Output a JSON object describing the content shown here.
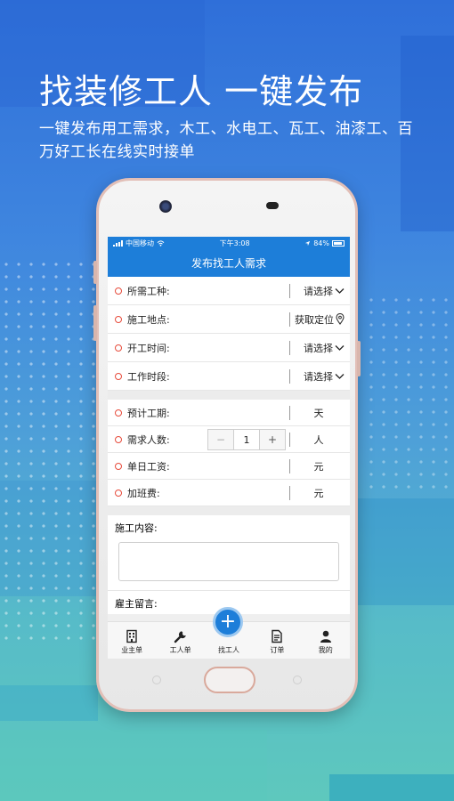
{
  "promo": {
    "headline": "找装修工人 一键发布",
    "subline": "一键发布用工需求，木工、水电工、瓦工、油漆工、百万好工长在线实时接单"
  },
  "status_bar": {
    "carrier": "中国移动",
    "time": "下午3:08",
    "battery": "84%"
  },
  "screen_title": "发布找工人需求",
  "form": {
    "worker_type": {
      "label": "所需工种:",
      "value": "请选择"
    },
    "location": {
      "label": "施工地点:",
      "value": "获取定位"
    },
    "start_time": {
      "label": "开工时间:",
      "value": "请选择"
    },
    "work_period": {
      "label": "工作时段:",
      "value": "请选择"
    },
    "duration": {
      "label": "预计工期:",
      "unit": "天"
    },
    "headcount": {
      "label": "需求人数:",
      "value": "1",
      "unit": "人",
      "minus": "−",
      "plus": "+"
    },
    "daily_wage": {
      "label": "单日工资:",
      "unit": "元"
    },
    "overtime": {
      "label": "加班费:",
      "unit": "元"
    },
    "content": {
      "label": "施工内容:"
    },
    "message": {
      "label": "雇主留言:"
    }
  },
  "tabbar": {
    "items": [
      {
        "label": "业主单",
        "icon": "building-icon"
      },
      {
        "label": "工人单",
        "icon": "wrench-icon"
      },
      {
        "label": "找工人",
        "icon": "plus-icon",
        "glyph": "+"
      },
      {
        "label": "订单",
        "icon": "document-icon"
      },
      {
        "label": "我的",
        "icon": "user-icon"
      }
    ]
  },
  "colors": {
    "primary": "#1d7ed9",
    "required_marker": "#e74c3c"
  }
}
